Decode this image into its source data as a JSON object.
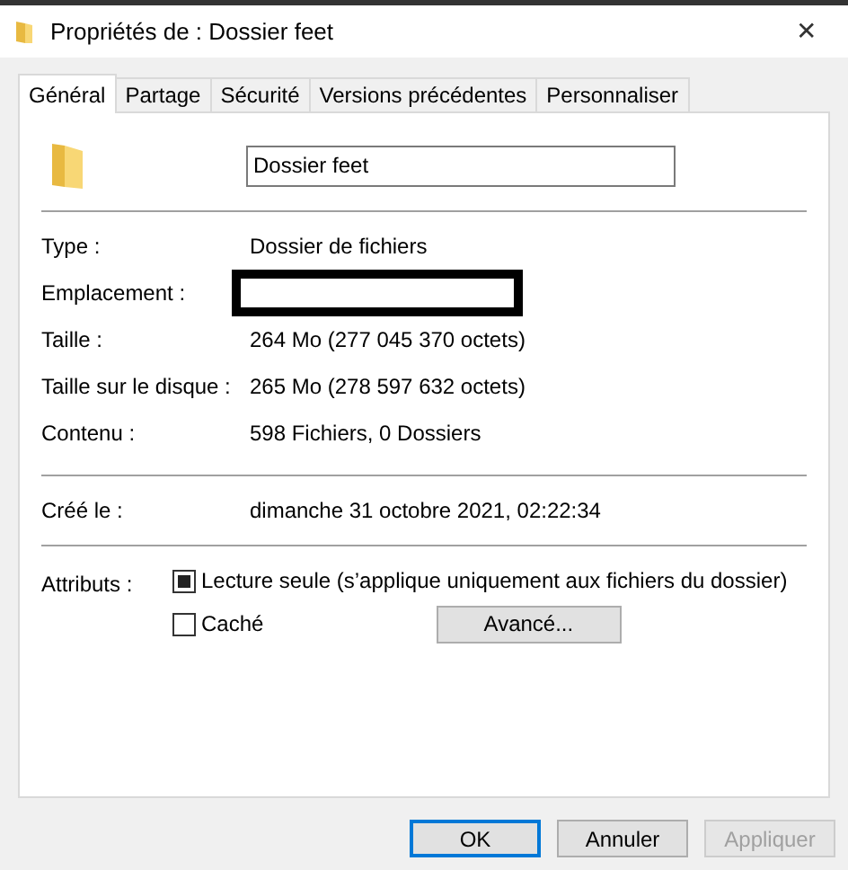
{
  "window": {
    "title": "Propriétés de : Dossier feet",
    "close": "✕"
  },
  "tabs": [
    {
      "label": "Général",
      "selected": true
    },
    {
      "label": "Partage",
      "selected": false
    },
    {
      "label": "Sécurité",
      "selected": false
    },
    {
      "label": "Versions précédentes",
      "selected": false
    },
    {
      "label": "Personnaliser",
      "selected": false
    }
  ],
  "name_field": {
    "value": "Dossier feet"
  },
  "groups": [
    [
      {
        "label": "Type :",
        "value": "Dossier de fichiers"
      },
      {
        "label": "Emplacement :",
        "redacted": true
      },
      {
        "label": "Taille :",
        "value": "264 Mo (277 045 370 octets)"
      },
      {
        "label": "Taille sur le disque :",
        "value": "265 Mo (278 597 632 octets)"
      },
      {
        "label": "Contenu :",
        "value": "598 Fichiers, 0 Dossiers"
      }
    ],
    [
      {
        "label": "Créé le :",
        "value": "dimanche 31 octobre 2021, 02:22:34"
      }
    ]
  ],
  "attributes": {
    "label": "Attributs :",
    "options": [
      {
        "label": "Lecture seule (s’applique uniquement aux fichiers du dossier)",
        "checked": true,
        "mixed": true
      },
      {
        "label": "Caché",
        "checked": false,
        "mixed": false
      }
    ],
    "advanced_button": "Avancé..."
  },
  "buttons": [
    {
      "label": "OK",
      "default": true,
      "disabled": false
    },
    {
      "label": "Annuler",
      "default": false,
      "disabled": false
    },
    {
      "label": "Appliquer",
      "default": false,
      "disabled": true
    }
  ]
}
